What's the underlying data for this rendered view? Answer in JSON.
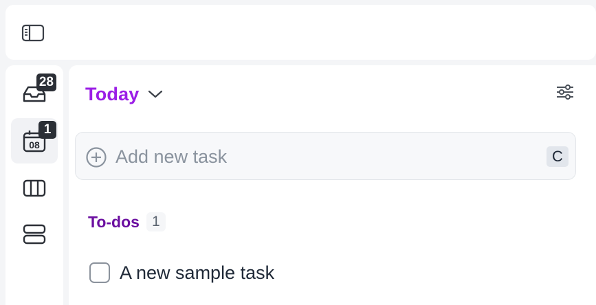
{
  "topbar": {
    "sidebar_toggle_icon": "sidebar-panel-icon"
  },
  "rail": {
    "items": [
      {
        "name": "inbox",
        "icon": "inbox-tray-icon",
        "badge": "28",
        "active": false
      },
      {
        "name": "today",
        "icon": "calendar-date-icon",
        "date_number": "08",
        "badge": "1",
        "active": true
      },
      {
        "name": "board",
        "icon": "columns-icon",
        "active": false
      },
      {
        "name": "rows",
        "icon": "rows-icon",
        "active": false
      }
    ]
  },
  "main": {
    "title": "Today",
    "title_icon": "chevron-down-icon",
    "filter_icon": "sliders-icon",
    "add_task": {
      "placeholder": "Add new task",
      "value": "",
      "shortcut": "C",
      "icon": "plus-circle-icon"
    },
    "sections": [
      {
        "title": "To-dos",
        "count": "1",
        "tasks": [
          {
            "text": "A new sample task",
            "done": false
          }
        ]
      }
    ]
  },
  "colors": {
    "accent_title": "#9b1ee6",
    "section_title": "#6b0fa0",
    "badge_bg": "#2b2f36",
    "background": "#f4f5f7"
  }
}
